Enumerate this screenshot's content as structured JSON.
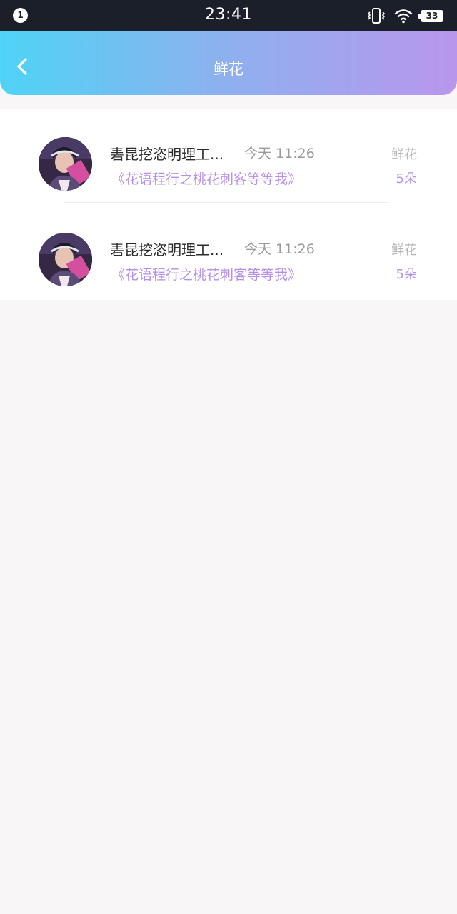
{
  "status_bar": {
    "notification_count": "1",
    "time": "23:41",
    "battery_level": "33"
  },
  "header": {
    "title": "鲜花",
    "gradient_start": "#4fd3f6",
    "gradient_end": "#b996ec",
    "back_icon": "chevron-left-icon"
  },
  "gifts": [
    {
      "name": "砉昆挖恣明理工...",
      "time": "今天 11:26",
      "category": "鲜花",
      "work_title": "《花语程行之桃花刺客等等我》",
      "quantity": "5朵"
    },
    {
      "name": "砉昆挖恣明理工...",
      "time": "今天 11:26",
      "category": "鲜花",
      "work_title": "《花语程行之桃花刺客等等我》",
      "quantity": "5朵"
    }
  ],
  "colors": {
    "accent_purple": "#b691e8",
    "status_bar_bg": "#1b1f2a",
    "page_bg": "#f8f6f7"
  }
}
